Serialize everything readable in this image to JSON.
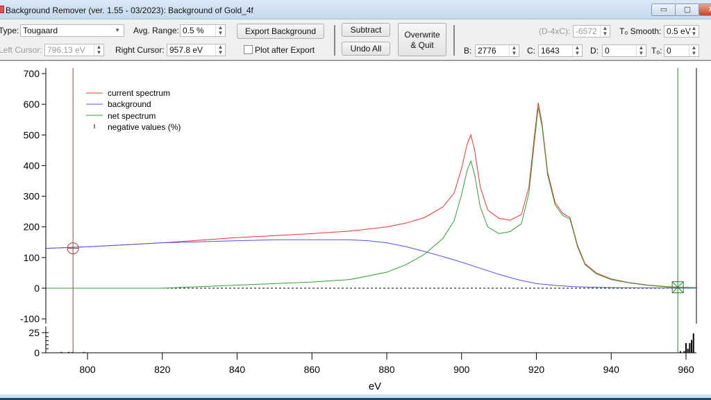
{
  "window": {
    "title": "Background Remover (ver. 1.55 - 03/2023): Background of Gold_4f",
    "minimize": "▭",
    "maximize": "▢",
    "close": "✕"
  },
  "toolbar": {
    "type_label": "Type:",
    "type_value": "Tougaard",
    "avg_range_label": "Avg. Range:",
    "avg_range_value": "0.5 %",
    "export_background": "Export Background",
    "left_cursor_label": "Left Cursor:",
    "left_cursor_value": "796.13 eV",
    "right_cursor_label": "Right Cursor:",
    "right_cursor_value": "957.8 eV",
    "plot_after_export": "Plot after Export",
    "plot_after_export_checked": false,
    "subtract": "Subtract",
    "undo_all": "Undo All",
    "overwrite_quit_1": "Overwrite",
    "overwrite_quit_2": "& Quit",
    "d4c_label": "(D-4xC):",
    "d4c_value": "-6572",
    "t0_smooth_label": "T₀ Smooth:",
    "t0_smooth_value": "0.5 eV",
    "b_label": "B:",
    "b_value": "2776",
    "c_label": "C:",
    "c_value": "1643",
    "d_label": "D:",
    "d_value": "0",
    "t0_label": "T₀:",
    "t0_value": "0"
  },
  "chart_data": {
    "type": "line",
    "xlabel": "eV",
    "xlim": [
      789,
      963
    ],
    "ylim": [
      -100,
      700
    ],
    "yticks": [
      "700",
      "600",
      "500",
      "400",
      "300",
      "200",
      "100",
      "0",
      "-100"
    ],
    "xticks": [
      "800",
      "820",
      "840",
      "860",
      "880",
      "900",
      "920",
      "940",
      "960"
    ],
    "lower_yticks": [
      "25",
      "0"
    ],
    "lower_ylim": [
      0,
      30
    ],
    "legend": [
      "current spectrum",
      "background",
      "net spectrum",
      "negative values (%)"
    ],
    "legend_placement": "top-left",
    "colors": {
      "current": "#f03030",
      "background": "#5050f0",
      "net": "#30a030",
      "left_cursor": "#a04040",
      "right_cursor": "#208020"
    },
    "left_cursor_ev": 796.13,
    "right_cursor_ev": 957.8,
    "series": [
      {
        "name": "current spectrum",
        "x": [
          789,
          800,
          820,
          840,
          860,
          870,
          880,
          885,
          890,
          895,
          898,
          900,
          901.5,
          902.5,
          903.5,
          905,
          907,
          910,
          913,
          916,
          918,
          919.5,
          920.5,
          921.5,
          923,
          925,
          927,
          929,
          931,
          933,
          936,
          940,
          945,
          950,
          955,
          958,
          963
        ],
        "y": [
          130,
          135,
          148,
          165,
          178,
          186,
          200,
          212,
          230,
          265,
          310,
          390,
          470,
          500,
          450,
          330,
          255,
          228,
          222,
          240,
          330,
          500,
          605,
          540,
          380,
          280,
          245,
          230,
          140,
          80,
          50,
          30,
          18,
          10,
          5,
          3,
          2
        ]
      },
      {
        "name": "background",
        "x": [
          789,
          800,
          820,
          840,
          850,
          860,
          870,
          875,
          880,
          885,
          890,
          895,
          900,
          905,
          910,
          915,
          920,
          925,
          930,
          935,
          940,
          950,
          963
        ],
        "y": [
          130,
          135,
          148,
          155,
          158,
          158,
          158,
          155,
          148,
          136,
          120,
          103,
          85,
          65,
          45,
          28,
          15,
          9,
          5,
          3,
          2,
          1,
          0
        ]
      },
      {
        "name": "net spectrum",
        "x": [
          789,
          800,
          820,
          840,
          860,
          870,
          880,
          885,
          890,
          895,
          898,
          900,
          901.5,
          902.5,
          903.5,
          905,
          907,
          910,
          913,
          916,
          918,
          919.5,
          920.5,
          921.5,
          923,
          925,
          927,
          929,
          931,
          933,
          936,
          940,
          945,
          950,
          955,
          958,
          963
        ],
        "y": [
          0,
          0,
          0,
          10,
          20,
          28,
          52,
          76,
          110,
          162,
          220,
          305,
          385,
          415,
          370,
          265,
          200,
          178,
          185,
          210,
          310,
          480,
          590,
          530,
          370,
          272,
          238,
          225,
          135,
          77,
          47,
          28,
          17,
          9,
          4,
          2,
          2
        ]
      }
    ],
    "negative_values": {
      "x": [
        793,
        795,
        796,
        799,
        958.5,
        959.5,
        960,
        960.5,
        961,
        961.5,
        962
      ],
      "y": [
        1,
        1,
        1,
        1,
        2,
        2,
        12,
        5,
        12,
        16,
        24
      ]
    }
  }
}
